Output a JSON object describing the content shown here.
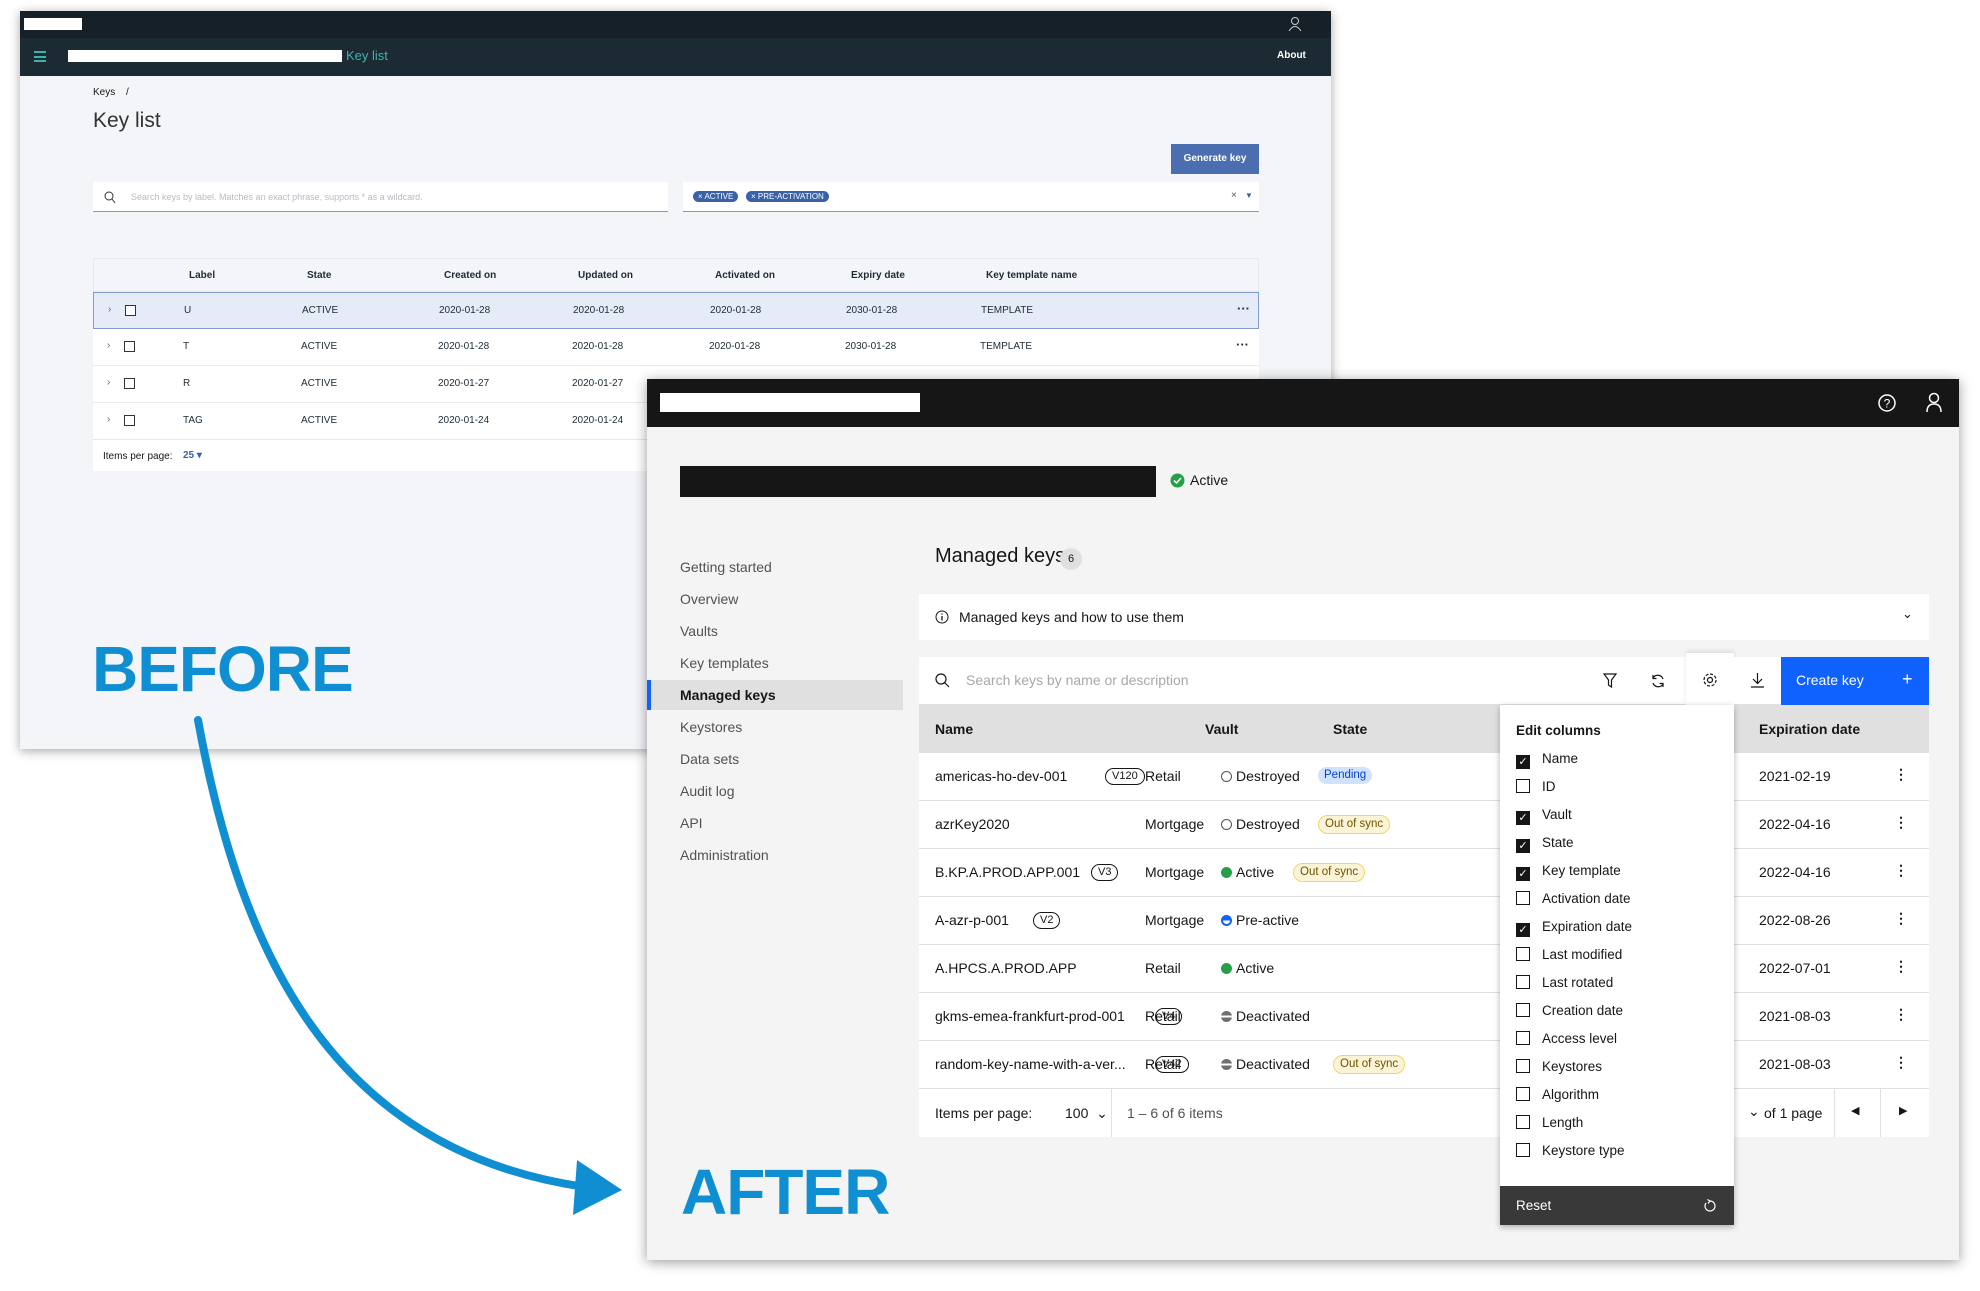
{
  "before": {
    "label": "BEFORE",
    "nav_title": "Key list",
    "about": "About",
    "breadcrumb": "Keys",
    "breadcrumb_sep": "/",
    "title": "Key list",
    "generate_button": "Generate key",
    "search_placeholder": "Search keys by label. Matches an exact phrase, supports * as a wildcard.",
    "filters": [
      "ACTIVE",
      "PRE-ACTIVATION"
    ],
    "clear": "×",
    "columns": [
      "Label",
      "State",
      "Created on",
      "Updated on",
      "Activated on",
      "Expiry date",
      "Key template name"
    ],
    "rows": [
      [
        "U",
        "ACTIVE",
        "2020-01-28",
        "2020-01-28",
        "2020-01-28",
        "2030-01-28",
        "TEMPLATE"
      ],
      [
        "T",
        "ACTIVE",
        "2020-01-28",
        "2020-01-28",
        "2020-01-28",
        "2030-01-28",
        "TEMPLATE"
      ],
      [
        "R",
        "ACTIVE",
        "2020-01-27",
        "2020-01-27",
        "",
        "",
        ""
      ],
      [
        "TAG",
        "ACTIVE",
        "2020-01-24",
        "2020-01-24",
        "",
        "",
        ""
      ]
    ],
    "items_per_page_label": "Items per page:",
    "items_per_page": "25"
  },
  "after": {
    "label": "AFTER",
    "status": "Active",
    "sidebar": [
      "Getting started",
      "Overview",
      "Vaults",
      "Key templates",
      "Managed keys",
      "Keystores",
      "Data sets",
      "Audit log",
      "API",
      "Administration"
    ],
    "sidebar_selected": 4,
    "heading": "Managed keys",
    "count": "6",
    "info": "Managed keys and how to use them",
    "search_placeholder": "Search keys by name or description",
    "create_button": "Create key",
    "columns": {
      "name": "Name",
      "vault": "Vault",
      "state": "State",
      "expiration": "Expiration date"
    },
    "rows": [
      {
        "name": "americas-ho-dev-001",
        "ver": "V120",
        "vault": "Retail",
        "state": "Destroyed",
        "icon": "destroyed",
        "tag": "Pending",
        "tag_type": "pending",
        "exp": "2021-02-19"
      },
      {
        "name": "azrKey2020",
        "ver": "",
        "vault": "Mortgage",
        "state": "Destroyed",
        "icon": "destroyed",
        "tag": "Out of sync",
        "tag_type": "warn",
        "exp": "2022-04-16"
      },
      {
        "name": "B.KP.A.PROD.APP.001",
        "ver": "V3",
        "vault": "Mortgage",
        "state": "Active",
        "icon": "active",
        "tag": "Out of sync",
        "tag_type": "warn",
        "exp": "2022-04-16"
      },
      {
        "name": "A-azr-p-001",
        "ver": "V2",
        "vault": "Mortgage",
        "state": "Pre-active",
        "icon": "preactive",
        "tag": "",
        "tag_type": "",
        "exp": "2022-08-26"
      },
      {
        "name": "A.HPCS.A.PROD.APP",
        "ver": "",
        "vault": "Retail",
        "state": "Active",
        "icon": "active",
        "tag": "",
        "tag_type": "",
        "exp": "2022-07-01"
      },
      {
        "name": "gkms-emea-frankfurt-prod-001",
        "ver": "V4",
        "vault": "Retail",
        "state": "Deactivated",
        "icon": "deactivated",
        "tag": "",
        "tag_type": "",
        "exp": "2021-08-03"
      },
      {
        "name": "random-key-name-with-a-ver...",
        "ver": "V42",
        "vault": "Retail",
        "state": "Deactivated",
        "icon": "deactivated",
        "tag": "Out of sync",
        "tag_type": "warn",
        "exp": "2021-08-03"
      }
    ],
    "edit_columns": {
      "title": "Edit columns",
      "items": [
        {
          "label": "Name",
          "checked": true
        },
        {
          "label": "ID",
          "checked": false
        },
        {
          "label": "Vault",
          "checked": true
        },
        {
          "label": "State",
          "checked": true
        },
        {
          "label": "Key template",
          "checked": true
        },
        {
          "label": "Activation date",
          "checked": false
        },
        {
          "label": "Expiration date",
          "checked": true
        },
        {
          "label": "Last modified",
          "checked": false
        },
        {
          "label": "Last rotated",
          "checked": false
        },
        {
          "label": "Creation date",
          "checked": false
        },
        {
          "label": "Access level",
          "checked": false
        },
        {
          "label": "Keystores",
          "checked": false
        },
        {
          "label": "Algorithm",
          "checked": false
        },
        {
          "label": "Length",
          "checked": false
        },
        {
          "label": "Keystore type",
          "checked": false
        }
      ],
      "reset": "Reset"
    },
    "footer": {
      "items_per_page_label": "Items per page:",
      "items_per_page": "100",
      "range": "1 – 6 of 6 items",
      "pages": "of 1 page"
    }
  },
  "colors": {
    "before_label": "#0f8fd1",
    "primary": "#0f62fe",
    "active": "#24a148",
    "legacy_button": "#4a6eb0"
  }
}
